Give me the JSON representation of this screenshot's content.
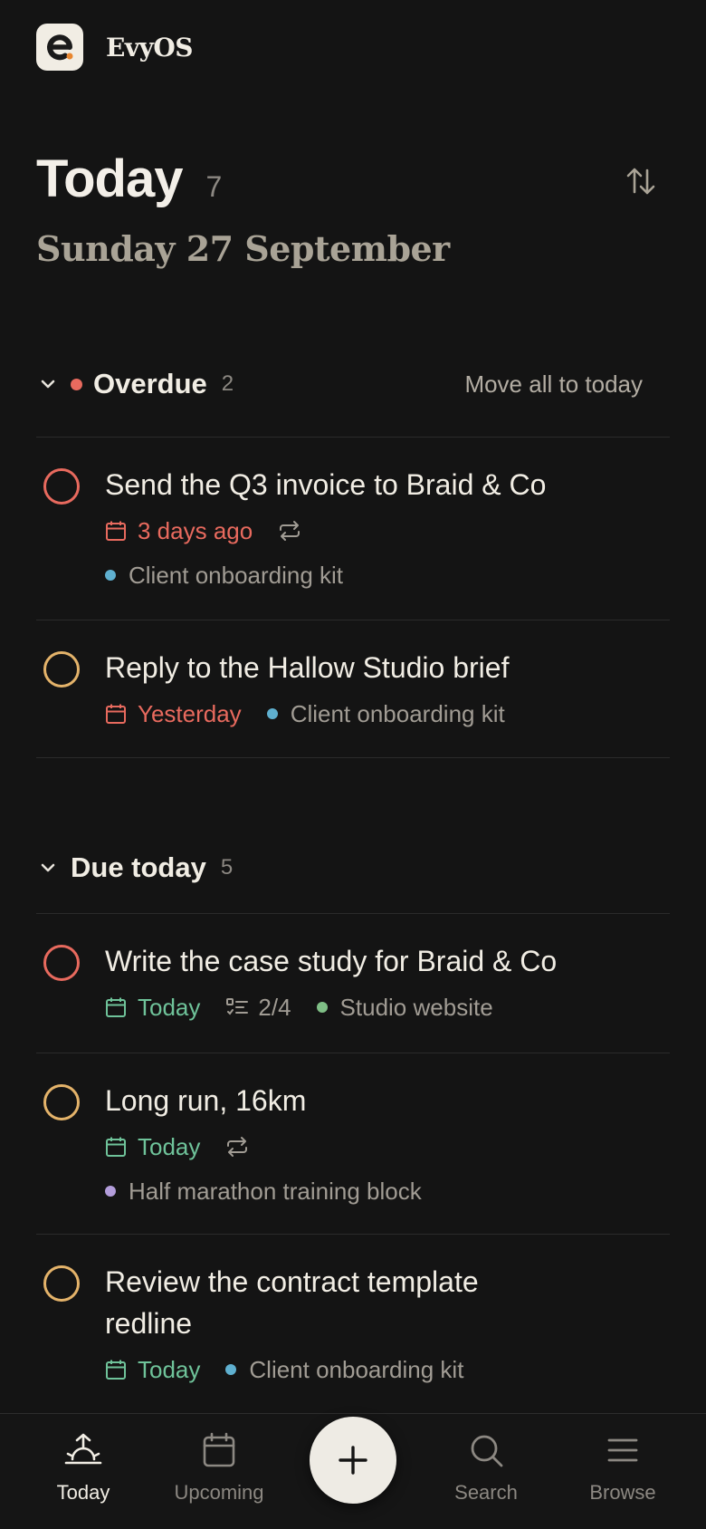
{
  "app": {
    "name": "EvyOS",
    "logo_letter": "e"
  },
  "header": {
    "title": "Today",
    "count": "7",
    "date": "Sunday 27 September",
    "sort_icon": "sort-arrows-icon"
  },
  "colors": {
    "overdue": "#e86a5e",
    "today": "#6fc39a",
    "p1": "#e86a5e",
    "p2": "#e4b36a",
    "accent_logo": "#e8862f"
  },
  "sections": {
    "overdue": {
      "title": "Overdue",
      "count": "2",
      "action": "Move all to today",
      "tasks": [
        {
          "title": "Send the Q3 invoice to Braid & Co",
          "due": "3 days ago",
          "recurring": true,
          "project": "Client onboarding kit",
          "project_color": "#5fb0d0",
          "priority": "p1"
        },
        {
          "title": "Reply to the Hallow Studio brief",
          "due": "Yesterday",
          "recurring": false,
          "project": "Client onboarding kit",
          "project_color": "#5fb0d0",
          "priority": "p2"
        }
      ]
    },
    "due_today": {
      "title": "Due today",
      "count": "5",
      "tasks": [
        {
          "title": "Write the case study for Braid & Co",
          "due": "Today",
          "subtasks": "2/4",
          "project": "Studio website",
          "project_color": "#7fbf86",
          "priority": "p1"
        },
        {
          "title": "Long run, 16km",
          "due": "Today",
          "recurring": true,
          "project": "Half marathon training block",
          "project_color": "#b39ddb",
          "priority": "p2"
        },
        {
          "title_line1": "Review the contract template",
          "title_line2": "redline",
          "due": "Today",
          "project": "Client onboarding kit",
          "project_color": "#5fb0d0",
          "priority": "p2"
        }
      ]
    }
  },
  "tabbar": {
    "items": [
      {
        "label": "Today",
        "icon": "sunrise-icon",
        "active": true
      },
      {
        "label": "Upcoming",
        "icon": "calendar-icon",
        "active": false
      },
      {
        "label": "Search",
        "icon": "search-icon",
        "active": false
      },
      {
        "label": "Browse",
        "icon": "menu-icon",
        "active": false
      }
    ],
    "add_icon": "plus-icon"
  }
}
